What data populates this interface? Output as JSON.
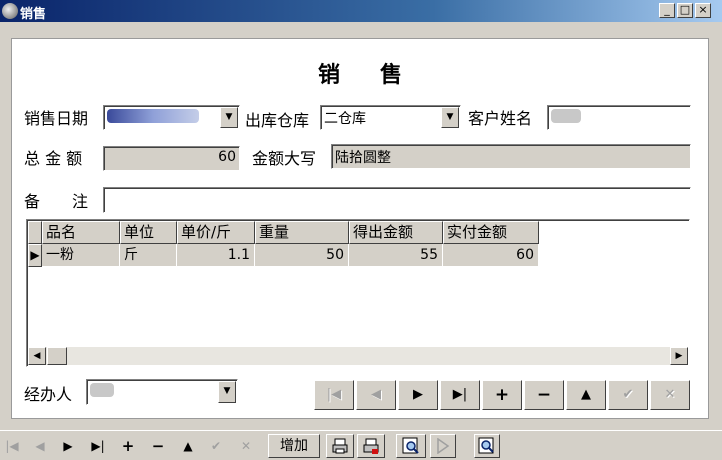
{
  "window": {
    "title": "销售",
    "icon": "app-icon",
    "controls": {
      "minimize": "_",
      "maximize": "□",
      "close": "×"
    }
  },
  "form": {
    "heading": "销售",
    "sale_date": {
      "label": "销售日期",
      "value": ""
    },
    "warehouse": {
      "label": "出库仓库",
      "value": "二仓库"
    },
    "customer": {
      "label": "客户姓名",
      "value": ""
    },
    "total": {
      "label": "总 金 额",
      "value": "60"
    },
    "total_words": {
      "label": "金额大写",
      "value": "陆拾圆整"
    },
    "remark": {
      "label": "备　　注",
      "value": ""
    },
    "handler": {
      "label": "经办人",
      "value": ""
    }
  },
  "grid": {
    "columns": [
      "品名",
      "单位",
      "单价/斤",
      "重量",
      "得出金额",
      "实付金额"
    ],
    "rows": [
      {
        "indicator": "▶",
        "name": "一粉",
        "unit": "斤",
        "price": "1.1",
        "weight": "50",
        "amount": "55",
        "paid": "60"
      }
    ]
  },
  "record_nav": {
    "first": "|◀",
    "prev": "◀",
    "next": "▶",
    "last": "▶|",
    "insert": "+",
    "delete": "−",
    "edit": "▲",
    "post": "✔",
    "cancel": "✕"
  },
  "bottom_toolbar": {
    "first": "|◀",
    "prev": "◀",
    "next": "▶",
    "last": "▶|",
    "insert": "+",
    "delete": "−",
    "edit": "▲",
    "post": "✔",
    "cancel": "✕",
    "add_label": "增加"
  },
  "colors": {
    "titlebar_start": "#0a246a",
    "titlebar_end": "#a6caf0",
    "face": "#d4d0c8",
    "readonly": "#d4d0c8"
  }
}
